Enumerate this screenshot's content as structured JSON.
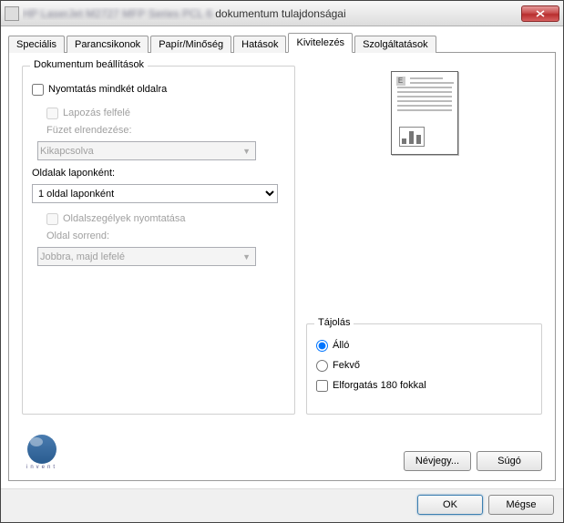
{
  "window": {
    "title_prefix": "HP LaserJet M2727 MFP Series PCL 6 ",
    "title_suffix": "dokumentum tulajdonságai"
  },
  "tabs": [
    {
      "label": "Speciális"
    },
    {
      "label": "Parancsikonok"
    },
    {
      "label": "Papír/Minőség"
    },
    {
      "label": "Hatások"
    },
    {
      "label": "Kivitelezés"
    },
    {
      "label": "Szolgáltatások"
    }
  ],
  "doc_settings": {
    "group_title": "Dokumentum beállítások",
    "print_both_sides": "Nyomtatás mindkét oldalra",
    "flip_up": "Lapozás felfelé",
    "booklet_label": "Füzet elrendezése:",
    "booklet_value": "Kikapcsolva",
    "pages_per_sheet_label": "Oldalak laponként:",
    "pages_per_sheet_value": "1 oldal laponként",
    "print_borders": "Oldalszegélyek nyomtatása",
    "page_order_label": "Oldal sorrend:",
    "page_order_value": "Jobbra, majd lefelé"
  },
  "orientation": {
    "group_title": "Tájolás",
    "portrait": "Álló",
    "landscape": "Fekvő",
    "rotate180": "Elforgatás 180 fokkal"
  },
  "logo": {
    "text": "invent"
  },
  "buttons": {
    "about": "Névjegy...",
    "help": "Súgó",
    "ok": "OK",
    "cancel": "Mégse"
  }
}
